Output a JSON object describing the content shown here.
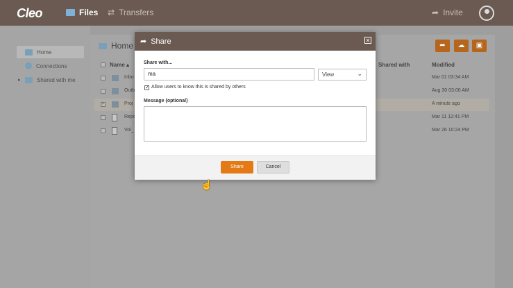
{
  "app": {
    "logo": "Cleo"
  },
  "nav": {
    "files": "Files",
    "transfers": "Transfers",
    "invite": "Invite"
  },
  "sidebar": {
    "items": [
      {
        "label": "Home"
      },
      {
        "label": "Connections"
      },
      {
        "label": "Shared with me"
      }
    ]
  },
  "panel": {
    "title": "Home",
    "columns": {
      "name": "Name ▴",
      "shared_with": "Shared with",
      "modified": "Modified"
    },
    "rows": [
      {
        "name": "Inbo",
        "modified": "Mar 01 03:34 AM",
        "checked": ""
      },
      {
        "name": "Outb",
        "modified": "Aug 30 03:00 AM",
        "checked": ""
      },
      {
        "name": "Proj",
        "modified": "A minute ago",
        "checked": "✓"
      },
      {
        "name": "Repo",
        "modified": "Mar 11 12:41 PM",
        "checked": ""
      },
      {
        "name": "Vol_",
        "modified": "Mar 26 10:24 PM",
        "checked": ""
      }
    ]
  },
  "modal": {
    "title": "Share",
    "share_with_label": "Share with...",
    "share_with_value": "ma",
    "permission": "View",
    "allow_label": "Allow users to know this is shared by others",
    "allow_checked": "✓",
    "message_label": "Message (optional)",
    "message_value": "",
    "share_button": "Share",
    "cancel_button": "Cancel"
  },
  "colors": {
    "accent": "#e37a16",
    "header": "#6a5a52"
  }
}
